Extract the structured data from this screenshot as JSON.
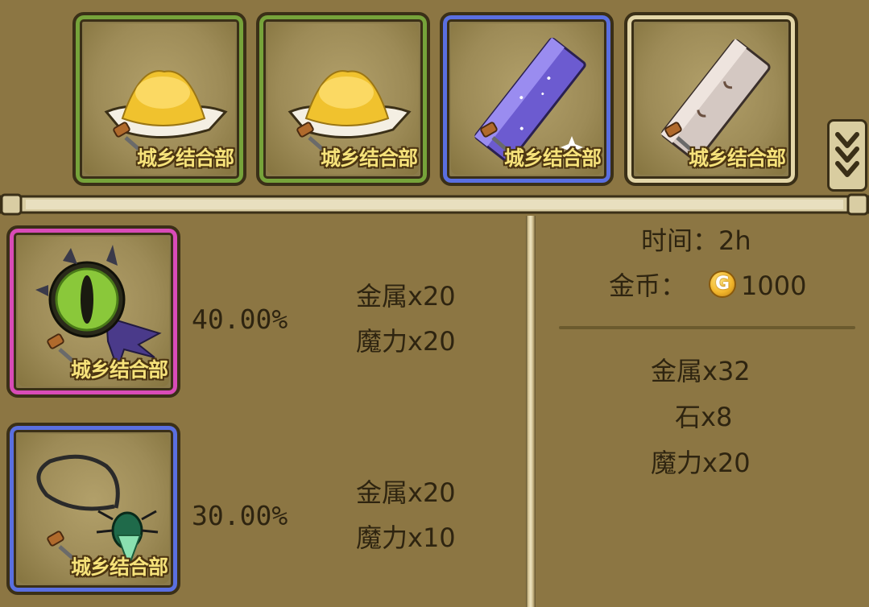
{
  "watermark": "城乡结合部",
  "top_materials": [
    {
      "name": "gold-sand",
      "rarity_color": "#76a33a"
    },
    {
      "name": "gold-sand",
      "rarity_color": "#76a33a"
    },
    {
      "name": "crystal-bar",
      "rarity_color": "#5a6fe0"
    },
    {
      "name": "stone-bar",
      "rarity_color": "#e3d6a8"
    }
  ],
  "outputs": [
    {
      "item": "eye-amulet",
      "rarity_color": "#d84bb7",
      "chance": "40.00%",
      "costs": [
        "金属x20",
        "魔力x20"
      ]
    },
    {
      "item": "beetle-necklace",
      "rarity_color": "#5a6fe0",
      "chance": "30.00%",
      "costs": [
        "金属x20",
        "魔力x10"
      ]
    }
  ],
  "info": {
    "time_label": "时间：",
    "time_value": "2h",
    "gold_label": "金币：",
    "gold_icon_letter": "G",
    "gold_value": "1000",
    "requirements": [
      "金属x32",
      "石x8",
      "魔力x20"
    ]
  },
  "scroll_icon": "double-chevron-down-icon"
}
